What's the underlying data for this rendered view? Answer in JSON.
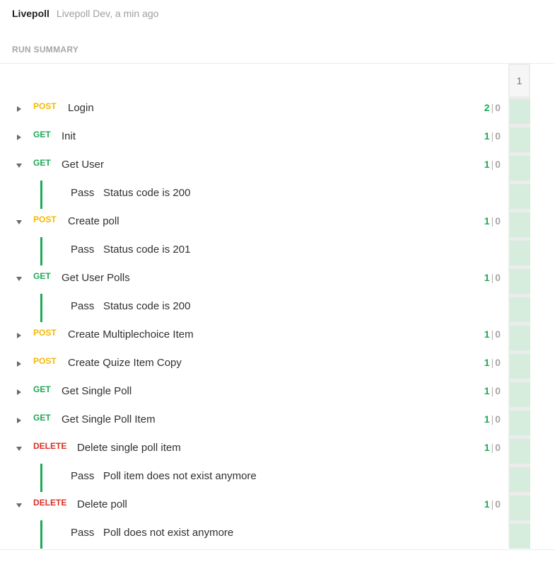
{
  "header": {
    "collection": "Livepoll",
    "environment_time": "Livepoll Dev, a min ago"
  },
  "summary_title": "RUN SUMMARY",
  "iteration_label": "1",
  "colors": {
    "post": "#f5b800",
    "get": "#1fa955",
    "delete": "#d93025",
    "pass_cell": "#d6eddd"
  },
  "requests": [
    {
      "method": "POST",
      "name": "Login",
      "expanded": false,
      "passed": "2",
      "failed": "0",
      "tests": []
    },
    {
      "method": "GET",
      "name": "Init",
      "expanded": false,
      "passed": "1",
      "failed": "0",
      "tests": []
    },
    {
      "method": "GET",
      "name": "Get User",
      "expanded": true,
      "passed": "1",
      "failed": "0",
      "tests": [
        {
          "status": "Pass",
          "name": "Status code is 200"
        }
      ]
    },
    {
      "method": "POST",
      "name": "Create poll",
      "expanded": true,
      "passed": "1",
      "failed": "0",
      "tests": [
        {
          "status": "Pass",
          "name": "Status code is 201"
        }
      ]
    },
    {
      "method": "GET",
      "name": "Get User Polls",
      "expanded": true,
      "passed": "1",
      "failed": "0",
      "tests": [
        {
          "status": "Pass",
          "name": "Status code is 200"
        }
      ]
    },
    {
      "method": "POST",
      "name": "Create Multiplechoice Item",
      "expanded": false,
      "passed": "1",
      "failed": "0",
      "tests": []
    },
    {
      "method": "POST",
      "name": "Create Quize Item Copy",
      "expanded": false,
      "passed": "1",
      "failed": "0",
      "tests": []
    },
    {
      "method": "GET",
      "name": "Get Single Poll",
      "expanded": false,
      "passed": "1",
      "failed": "0",
      "tests": []
    },
    {
      "method": "GET",
      "name": "Get Single Poll Item",
      "expanded": false,
      "passed": "1",
      "failed": "0",
      "tests": []
    },
    {
      "method": "DELETE",
      "name": "Delete single poll item",
      "expanded": true,
      "passed": "1",
      "failed": "0",
      "tests": [
        {
          "status": "Pass",
          "name": "Poll item does not exist anymore"
        }
      ]
    },
    {
      "method": "DELETE",
      "name": "Delete poll",
      "expanded": true,
      "passed": "1",
      "failed": "0",
      "tests": [
        {
          "status": "Pass",
          "name": "Poll does not exist anymore"
        }
      ]
    }
  ]
}
